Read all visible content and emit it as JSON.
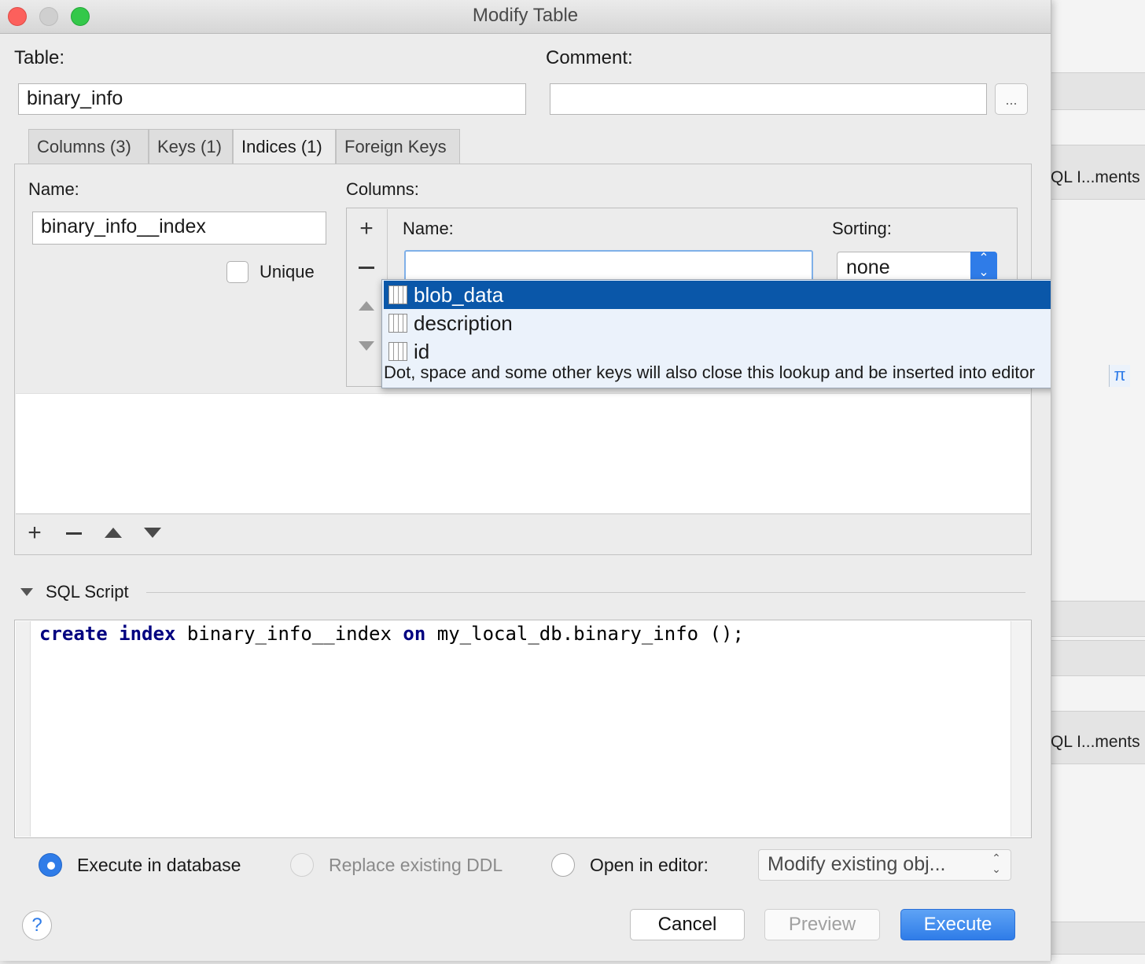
{
  "window": {
    "title": "Modify Table"
  },
  "background_window": {
    "item1": "QL I...ments",
    "item2": "QL I...ments"
  },
  "table_section": {
    "table_label": "Table:",
    "table_value": "binary_info",
    "comment_label": "Comment:",
    "comment_value": "",
    "comment_more_label": "..."
  },
  "tabs": [
    {
      "label": "Columns (3)"
    },
    {
      "label": "Keys (1)"
    },
    {
      "label": "Indices (1)"
    },
    {
      "label": "Foreign Keys"
    }
  ],
  "index": {
    "name_label": "Name:",
    "name_value": "binary_info__index",
    "unique_label": "Unique",
    "unique_checked": false,
    "columns_label": "Columns:",
    "col_name_label": "Name:",
    "sorting_label": "Sorting:",
    "sorting_value": "none",
    "col_name_value": ""
  },
  "lookup": {
    "items": [
      "blob_data",
      "description",
      "id"
    ],
    "selected": "blob_data",
    "hint": "Dot, space and some other keys will also close this lookup and be inserted into editor",
    "pi_icon": "π"
  },
  "sql": {
    "header": "SQL Script",
    "code_tokens": [
      "create",
      "index",
      "binary_info__index",
      "on",
      "my_local_db.binary_info",
      "();"
    ]
  },
  "options": {
    "execute_label": "Execute in database",
    "replace_label": "Replace existing DDL",
    "open_label": "Open in editor:",
    "mode_value": "Modify existing obj...",
    "selected": "execute"
  },
  "buttons": {
    "help": "?",
    "cancel": "Cancel",
    "preview": "Preview",
    "execute": "Execute"
  },
  "colors": {
    "accent": "#2f7ce8",
    "selection": "#0a57a9",
    "keyword": "#000080"
  }
}
